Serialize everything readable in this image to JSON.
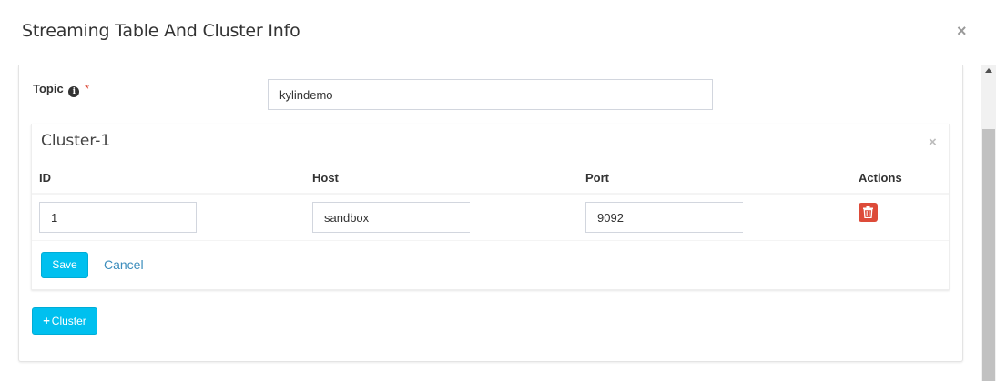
{
  "modal": {
    "title": "Streaming Table And Cluster Info",
    "close_glyph": "×"
  },
  "topic": {
    "label": "Topic",
    "info_glyph": "i",
    "required_mark": "*",
    "value": "kylindemo"
  },
  "cluster": {
    "title": "Cluster-1",
    "close_glyph": "×",
    "columns": [
      "ID",
      "Host",
      "Port",
      "Actions"
    ],
    "rows": [
      {
        "id": "1",
        "host": "sandbox",
        "port": "9092"
      }
    ],
    "save_label": "Save",
    "cancel_label": "Cancel"
  },
  "add_cluster": {
    "plus_glyph": "+",
    "label": "Cluster"
  },
  "colors": {
    "primary_info": "#00c0ef",
    "danger": "#dd4b39",
    "link": "#3c8dbc"
  },
  "icons": {
    "info": "info-circle-icon",
    "delete": "trash-icon",
    "close": "close-icon",
    "add": "plus-icon"
  }
}
